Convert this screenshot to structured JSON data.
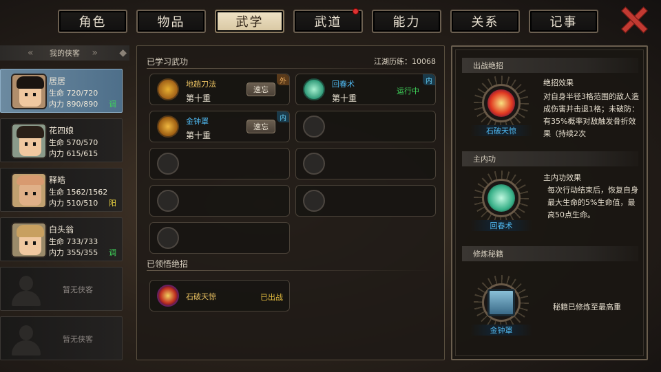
{
  "tabs": [
    {
      "label": "角色",
      "active": false,
      "badge": false
    },
    {
      "label": "物品",
      "active": false,
      "badge": false
    },
    {
      "label": "武学",
      "active": true,
      "badge": false
    },
    {
      "label": "武道",
      "active": false,
      "badge": true
    },
    {
      "label": "能力",
      "active": false,
      "badge": false
    },
    {
      "label": "关系",
      "active": false,
      "badge": false
    },
    {
      "label": "记事",
      "active": false,
      "badge": false
    }
  ],
  "left": {
    "header": "我的侠客",
    "characters": [
      {
        "name": "居居",
        "hp": "生命 720/720",
        "mp": "内力 890/890",
        "tag": "调",
        "active": true
      },
      {
        "name": "花四娘",
        "hp": "生命 570/570",
        "mp": "内力 615/615",
        "tag": "",
        "active": false
      },
      {
        "name": "释皓",
        "hp": "生命 1562/1562",
        "mp": "内力 510/510",
        "tag": "阳",
        "active": false
      },
      {
        "name": "白头翁",
        "hp": "生命 733/733",
        "mp": "内力 355/355",
        "tag": "调",
        "active": false
      }
    ],
    "empty_label": "暂无侠客"
  },
  "mid": {
    "learned_title": "已学习武功",
    "world_exp": "江湖历练：10068",
    "skills": [
      {
        "name": "地趟刀法",
        "level": "第十重",
        "button": "速忘",
        "corner": "外"
      },
      {
        "name": "回春术",
        "level": "第十重",
        "status": "运行中",
        "corner": "内"
      },
      {
        "name": "金钟罩",
        "level": "第十重",
        "button": "速忘",
        "corner": "内"
      }
    ],
    "ultimate_title": "已领悟绝招",
    "ultimate": {
      "name": "石破天惊",
      "status": "已出战"
    }
  },
  "right": {
    "sec1": "出战绝招",
    "sec1_medal": "石破天惊",
    "sec1_title": "绝招效果",
    "sec1_text": "对自身半径3格范围的敌人造成伤害并击退1格；未破防：有35%概率对敌触发骨折效果（持续2次",
    "sec2": "主内功",
    "sec2_medal": "回春术",
    "sec2_title": "主内功效果",
    "sec2_text": "每次行动结束后，恢复自身最大生命的5%生命值，最高50点生命。",
    "sec3": "修炼秘籍",
    "sec3_medal": "金钟罩",
    "sec3_text": "秘籍已修炼至最高重"
  }
}
